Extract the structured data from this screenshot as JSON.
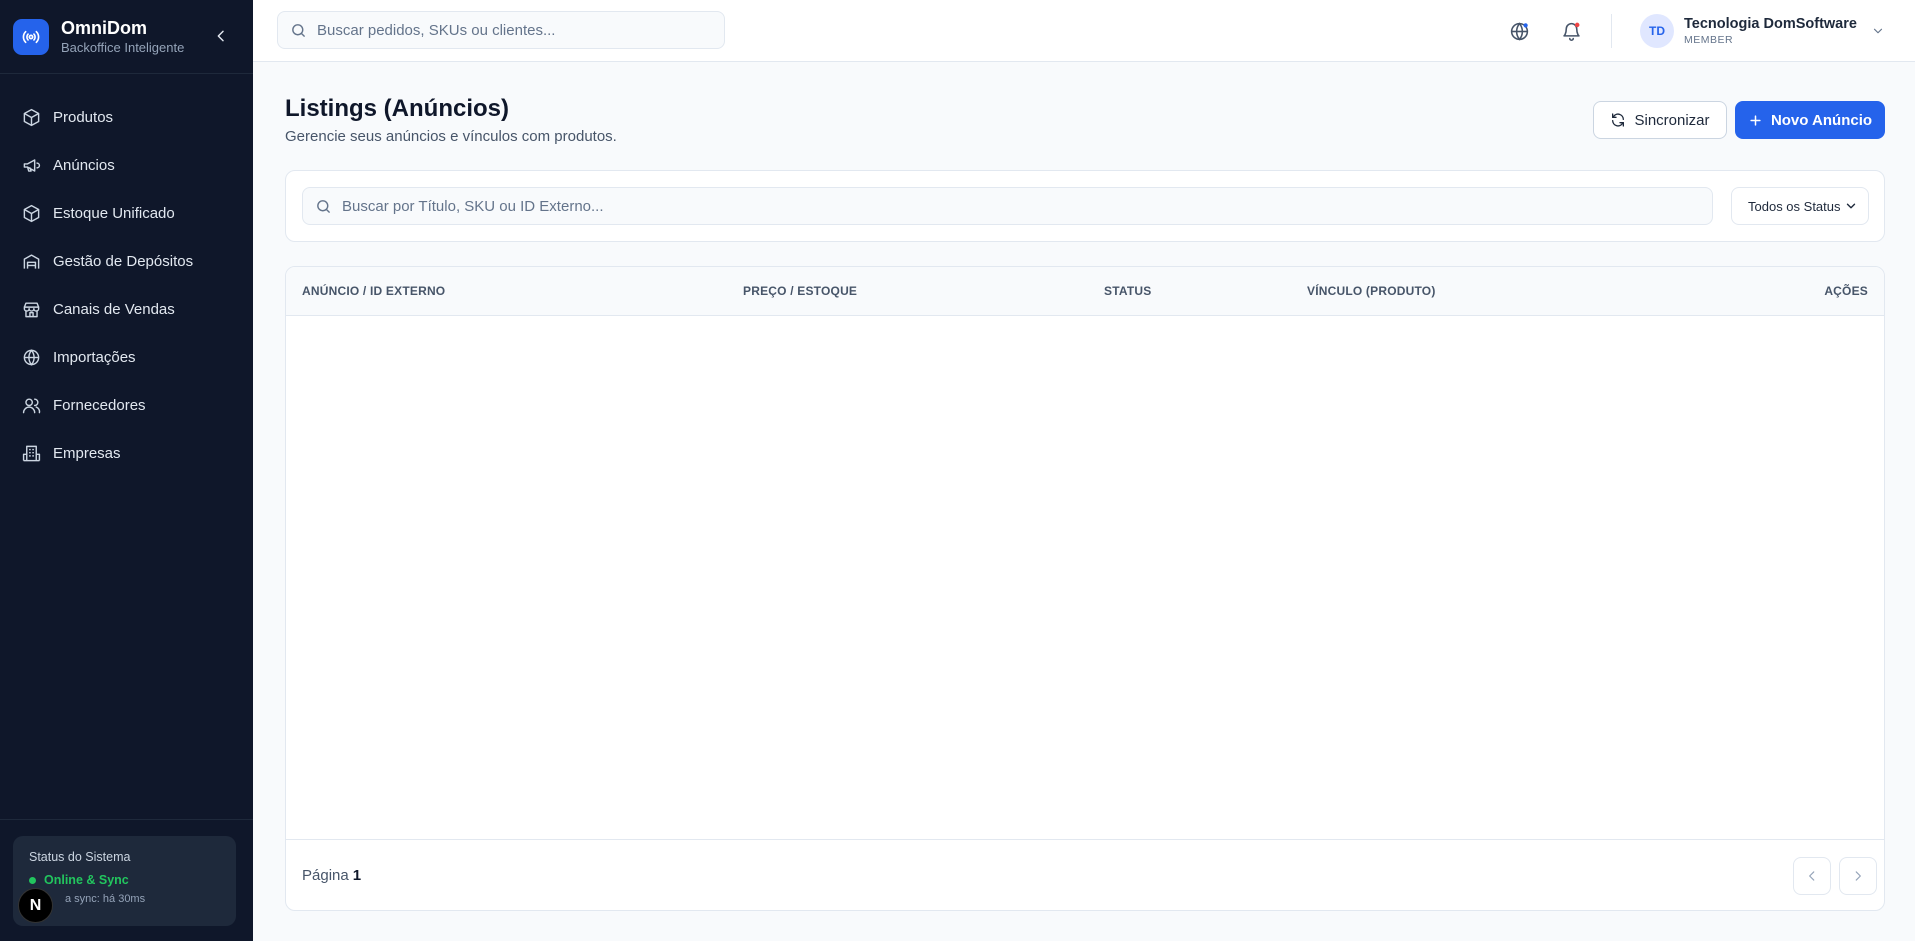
{
  "brand": {
    "name": "OmniDom",
    "subtitle": "Backoffice Inteligente"
  },
  "sidebar": {
    "items": [
      {
        "label": "Produtos",
        "icon": "box-icon"
      },
      {
        "label": "Anúncios",
        "icon": "megaphone-icon"
      },
      {
        "label": "Estoque Unificado",
        "icon": "box-icon"
      },
      {
        "label": "Gestão de Depósitos",
        "icon": "warehouse-icon"
      },
      {
        "label": "Canais de Vendas",
        "icon": "store-icon"
      },
      {
        "label": "Importações",
        "icon": "globe-icon"
      },
      {
        "label": "Fornecedores",
        "icon": "users-icon"
      },
      {
        "label": "Empresas",
        "icon": "building-icon"
      }
    ],
    "status": {
      "title": "Status do Sistema",
      "state": "Online & Sync",
      "last_sync": "a sync: há 30ms",
      "badge": "N"
    }
  },
  "header": {
    "search_placeholder": "Buscar pedidos, SKUs ou clientes...",
    "user": {
      "initials": "TD",
      "name": "Tecnologia DomSoftware",
      "role": "MEMBER"
    }
  },
  "page": {
    "title": "Listings (Anúncios)",
    "subtitle": "Gerencie seus anúncios e vínculos com produtos.",
    "sync_label": "Sincronizar",
    "new_label": "Novo Anúncio"
  },
  "filters": {
    "search_placeholder": "Buscar por Título, SKU ou ID Externo...",
    "status_selected": "Todos os Status"
  },
  "table": {
    "columns": [
      "ANÚNCIO / ID EXTERNO",
      "PREÇO / ESTOQUE",
      "STATUS",
      "VÍNCULO (PRODUTO)",
      "AÇÕES"
    ],
    "rows": []
  },
  "pagination": {
    "label": "Página",
    "current": "1"
  },
  "colors": {
    "sidebar_bg": "#0f172a",
    "accent": "#2563eb",
    "online": "#22c55e",
    "notification": "#ef4444"
  }
}
